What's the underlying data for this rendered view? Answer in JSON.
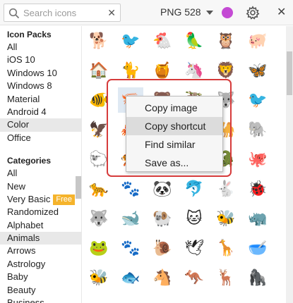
{
  "search": {
    "placeholder": "Search icons",
    "value": ""
  },
  "format": {
    "label": "PNG 528"
  },
  "accent_color": "#c44ad4",
  "sidebar": {
    "packs_title": "Icon Packs",
    "packs": [
      "All",
      "iOS 10",
      "Windows 10",
      "Windows 8",
      "Material",
      "Android 4",
      "Color",
      "Office"
    ],
    "selected_pack": "Color",
    "categories_title": "Categories",
    "categories": [
      "All",
      "New",
      "Very Basic",
      "Randomized",
      "Alphabet",
      "Animals",
      "Arrows",
      "Astrology",
      "Baby",
      "Beauty",
      "Business"
    ],
    "selected_category": "Animals",
    "free_badge": "Free"
  },
  "icons": [
    [
      "dog-icon",
      "🐕"
    ],
    [
      "bird-icon",
      "🐦"
    ],
    [
      "chicken-icon",
      "🐔"
    ],
    [
      "parrot-icon",
      "🦜"
    ],
    [
      "owl-icon",
      "🦉"
    ],
    [
      "pig-icon",
      "🐖"
    ],
    [
      "doghouse-icon",
      "🏠"
    ],
    [
      "cat-icon",
      "🐈"
    ],
    [
      "beehive-icon",
      "🍯"
    ],
    [
      "unicorn-icon",
      "🦄"
    ],
    [
      "lion-icon",
      "🦁"
    ],
    [
      "butterfly-icon",
      "🦋"
    ],
    [
      "fish-icon",
      "🐠"
    ],
    [
      "shrimp-icon",
      "🦐"
    ],
    [
      "bear-icon",
      "🐻"
    ],
    [
      "sloth-icon",
      "🦥"
    ],
    [
      "wolf-icon",
      "🐺"
    ],
    [
      "hummingbird-icon",
      "🐦"
    ],
    [
      "eagle-icon",
      "🦅"
    ],
    [
      "crab-icon",
      "🦀"
    ],
    [
      "turtle-icon",
      "🐢"
    ],
    [
      "frog-icon",
      "🐸"
    ],
    [
      "camel-icon",
      "🐪"
    ],
    [
      "elephant-icon",
      "🐘"
    ],
    [
      "sheep-icon",
      "🐑"
    ],
    [
      "tiger-icon",
      "🐅"
    ],
    [
      "bat-icon",
      "🦇"
    ],
    [
      "kangaroo-icon",
      "🦘"
    ],
    [
      "crocodile-icon",
      "🐊"
    ],
    [
      "octopus-icon",
      "🐙"
    ],
    [
      "leopard-icon",
      "🐆"
    ],
    [
      "paw-print-icon",
      "🐾"
    ],
    [
      "panda-icon",
      "🐼"
    ],
    [
      "dolphin-icon",
      "🐬"
    ],
    [
      "rabbit-icon",
      "🐇"
    ],
    [
      "ladybug-icon",
      "🐞"
    ],
    [
      "wolf-head-icon",
      "🐺"
    ],
    [
      "whale-icon",
      "🐋"
    ],
    [
      "sheep-head-icon",
      "🐏"
    ],
    [
      "cat-head-icon",
      "🐱"
    ],
    [
      "bee-icon",
      "🐝"
    ],
    [
      "rhino-icon",
      "🦏"
    ],
    [
      "frog-sitting-icon",
      "🐸"
    ],
    [
      "paw-icon",
      "🐾"
    ],
    [
      "snail-icon",
      "🐌"
    ],
    [
      "bird-flying-icon",
      "🕊"
    ],
    [
      "giraffe-icon",
      "🦒"
    ],
    [
      "pet-bowl-icon",
      "🥣"
    ],
    [
      "wasp-icon",
      "🐝"
    ],
    [
      "fishbowl-icon",
      "🐟"
    ],
    [
      "seahorse-icon",
      "🐴"
    ],
    [
      "kangaroo-jump-icon",
      "🦘"
    ],
    [
      "deer-icon",
      "🦌"
    ],
    [
      "gorilla-icon",
      "🦍"
    ]
  ],
  "context_menu": {
    "items": [
      "Copy image",
      "Copy shortcut",
      "Find similar",
      "Save as..."
    ],
    "hovered": "Copy shortcut"
  }
}
